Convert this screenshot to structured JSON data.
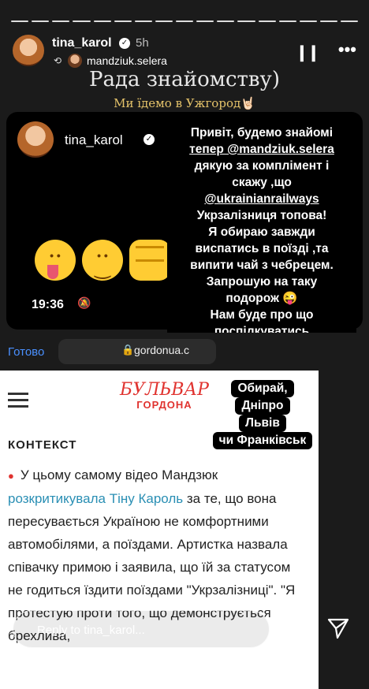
{
  "header": {
    "username": "tina_karol",
    "time": "5h",
    "repost_username": "mandziuk.selera",
    "pause_icon": "pause-icon",
    "more_icon": "more-icon"
  },
  "story": {
    "title": "Рада знайомству)",
    "subtitle": "Ми їдемо в Ужгород🤘🏻"
  },
  "post_card": {
    "username": "tina_karol",
    "clock": "19:36",
    "emojis": [
      "😛",
      "😊",
      "✊"
    ]
  },
  "bubble_lines": [
    "Привіт, будемо знайомі",
    "тепер @mandziuk.selera",
    "дякую за комплімент і",
    "скажу ,що",
    "@ukrainianrailways",
    "Укрзалізниця топова!",
    "Я обираю завжди",
    "виспатись в поїзді ,та",
    "випити чай з чебрецем.",
    "Запрошую на таку",
    "подорож 😜",
    "Нам буде про що",
    "поспілкуватись"
  ],
  "browser": {
    "done_label": "Готово",
    "url": "gordonua.c"
  },
  "webpage": {
    "logo_line1": "БУЛЬВАР",
    "logo_line2": "ГОРДОНА",
    "section": "КОНТЕКСТ",
    "article_before_link": "У цьому самому відео Мандзюк",
    "article_link": "розкритикувала Тіну Кароль",
    "article_after_link": "за те, що вона пересувається Україною не комфортними автомобілями, а поїздами. Артистка назвала співачку примою і заявила, що їй за статусом не годиться їздити поїздами \"Укрзалізниці\". \"Я протестую проти того, що демонструється брехлива,"
  },
  "bubble2_lines": [
    "Обирай,",
    "Дніпро",
    "Львів",
    "чи Франківськ"
  ],
  "reply": {
    "placeholder": "Reply to tina_karol..."
  }
}
